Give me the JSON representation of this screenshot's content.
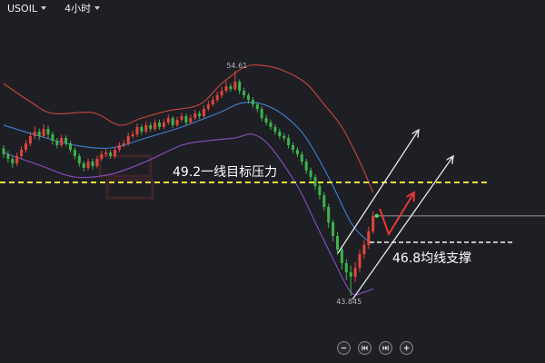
{
  "header": {
    "symbol": "USOIL",
    "timeframe": "4小时"
  },
  "controls": [
    {
      "icon": "zoom-out-icon"
    },
    {
      "icon": "jump-start-icon"
    },
    {
      "icon": "jump-end-icon"
    },
    {
      "icon": "zoom-in-icon"
    }
  ],
  "colors": {
    "background": "#1e1f24",
    "up": "#e0453c",
    "down": "#3cb44b",
    "band_upper": "#c9463d",
    "band_middle": "#3f7fd6",
    "band_lower": "#8a4fc0",
    "resistance": "#f2e535",
    "support": "#bdbdbd",
    "price_line": "#9a9a9a",
    "price_dot": "#4cd964",
    "arrow": "#e8e8e8",
    "forecast": "#e53935"
  },
  "chart_data": {
    "type": "candlestick",
    "ylim": [
      40.63,
      58.0
    ],
    "grid": false,
    "high_label": "54.61",
    "low_label": "43.845",
    "candles": [
      [
        50.9,
        51.05,
        50.45,
        50.62
      ],
      [
        50.62,
        50.78,
        50.22,
        50.4
      ],
      [
        50.4,
        50.55,
        49.98,
        50.18
      ],
      [
        50.18,
        50.7,
        50.05,
        50.53
      ],
      [
        50.53,
        51.0,
        50.4,
        50.83
      ],
      [
        50.83,
        51.3,
        50.7,
        51.14
      ],
      [
        51.14,
        51.68,
        51.0,
        51.49
      ],
      [
        51.49,
        51.95,
        51.35,
        51.7
      ],
      [
        51.7,
        51.85,
        51.3,
        51.49
      ],
      [
        51.49,
        52.05,
        51.4,
        51.83
      ],
      [
        51.83,
        51.98,
        51.4,
        51.57
      ],
      [
        51.57,
        51.7,
        51.1,
        51.27
      ],
      [
        51.27,
        51.4,
        50.9,
        51.05
      ],
      [
        51.05,
        51.55,
        50.95,
        51.4
      ],
      [
        51.4,
        51.52,
        51.0,
        51.14
      ],
      [
        51.14,
        51.25,
        50.7,
        50.83
      ],
      [
        50.83,
        50.95,
        50.38,
        50.53
      ],
      [
        50.53,
        50.65,
        50.02,
        50.18
      ],
      [
        50.18,
        50.3,
        49.8,
        49.97
      ],
      [
        49.97,
        50.42,
        49.85,
        50.27
      ],
      [
        50.27,
        50.4,
        49.9,
        50.05
      ],
      [
        50.05,
        50.55,
        49.95,
        50.4
      ],
      [
        50.4,
        50.78,
        50.3,
        50.62
      ],
      [
        50.62,
        50.88,
        50.5,
        50.7
      ],
      [
        50.7,
        50.82,
        50.4,
        50.53
      ],
      [
        50.53,
        50.98,
        50.42,
        50.83
      ],
      [
        50.83,
        51.2,
        50.72,
        51.05
      ],
      [
        51.05,
        51.3,
        50.95,
        51.14
      ],
      [
        51.14,
        51.65,
        51.02,
        51.49
      ],
      [
        51.49,
        51.75,
        51.38,
        51.57
      ],
      [
        51.57,
        52.1,
        51.45,
        51.92
      ],
      [
        51.92,
        52.05,
        51.55,
        51.7
      ],
      [
        51.7,
        52.2,
        51.6,
        52.01
      ],
      [
        52.01,
        52.15,
        51.7,
        51.83
      ],
      [
        51.83,
        52.3,
        51.72,
        52.14
      ],
      [
        52.14,
        52.28,
        51.8,
        51.92
      ],
      [
        51.92,
        52.3,
        51.82,
        52.14
      ],
      [
        52.14,
        52.52,
        52.02,
        52.35
      ],
      [
        52.35,
        52.45,
        51.88,
        52.01
      ],
      [
        52.01,
        52.42,
        51.92,
        52.27
      ],
      [
        52.27,
        52.6,
        52.15,
        52.44
      ],
      [
        52.44,
        52.55,
        52.02,
        52.14
      ],
      [
        52.14,
        52.5,
        52.05,
        52.35
      ],
      [
        52.35,
        52.75,
        52.25,
        52.57
      ],
      [
        52.57,
        52.7,
        52.3,
        52.44
      ],
      [
        52.44,
        52.95,
        52.35,
        52.79
      ],
      [
        52.79,
        53.18,
        52.68,
        53.0
      ],
      [
        53.0,
        53.4,
        52.9,
        53.22
      ],
      [
        53.22,
        53.62,
        53.1,
        53.44
      ],
      [
        53.44,
        53.85,
        53.3,
        53.66
      ],
      [
        53.66,
        54.1,
        53.55,
        53.87
      ],
      [
        53.87,
        54.0,
        53.6,
        53.74
      ],
      [
        53.74,
        54.61,
        53.65,
        54.09
      ],
      [
        54.09,
        54.2,
        53.5,
        53.66
      ],
      [
        53.66,
        53.8,
        53.3,
        53.44
      ],
      [
        53.44,
        53.55,
        53.05,
        53.22
      ],
      [
        53.22,
        53.35,
        52.85,
        53.0
      ],
      [
        53.0,
        53.12,
        52.62,
        52.79
      ],
      [
        52.79,
        52.9,
        52.2,
        52.35
      ],
      [
        52.35,
        52.5,
        52.0,
        52.14
      ],
      [
        52.14,
        52.28,
        51.78,
        51.92
      ],
      [
        51.92,
        52.05,
        51.55,
        51.7
      ],
      [
        51.7,
        51.85,
        51.35,
        51.49
      ],
      [
        51.49,
        51.62,
        51.25,
        51.4
      ],
      [
        51.4,
        51.55,
        50.9,
        51.05
      ],
      [
        51.05,
        51.18,
        50.68,
        50.83
      ],
      [
        50.83,
        50.95,
        50.48,
        50.62
      ],
      [
        50.62,
        50.75,
        50.1,
        50.27
      ],
      [
        50.27,
        50.4,
        49.68,
        49.84
      ],
      [
        49.84,
        49.98,
        49.35,
        49.53
      ],
      [
        49.53,
        49.65,
        48.92,
        49.1
      ],
      [
        49.1,
        49.25,
        48.45,
        48.66
      ],
      [
        48.66,
        48.8,
        47.9,
        48.1
      ],
      [
        48.1,
        48.25,
        47.1,
        47.36
      ],
      [
        47.36,
        47.5,
        46.45,
        46.71
      ],
      [
        46.71,
        46.9,
        45.8,
        46.06
      ],
      [
        46.06,
        46.25,
        45.1,
        45.41
      ],
      [
        45.41,
        45.6,
        44.6,
        44.97
      ],
      [
        44.97,
        45.3,
        43.845,
        44.76
      ],
      [
        44.76,
        45.45,
        44.5,
        45.19
      ],
      [
        45.19,
        46.05,
        45.0,
        45.84
      ],
      [
        45.84,
        46.5,
        45.6,
        46.28
      ],
      [
        46.28,
        47.15,
        46.1,
        46.93
      ],
      [
        46.93,
        47.9,
        46.8,
        47.67
      ]
    ],
    "bollinger": {
      "upper": [
        [
          0,
          54.0
        ],
        [
          6,
          53.13
        ],
        [
          11,
          52.57
        ],
        [
          20,
          52.61
        ],
        [
          26,
          52.01
        ],
        [
          31,
          52.35
        ],
        [
          37,
          52.7
        ],
        [
          44,
          53.0
        ],
        [
          49,
          54.0
        ],
        [
          54,
          54.78
        ],
        [
          58,
          54.87
        ],
        [
          63,
          54.61
        ],
        [
          68,
          54.0
        ],
        [
          72,
          53.0
        ],
        [
          76,
          51.92
        ],
        [
          80,
          50.27
        ],
        [
          83,
          48.79
        ]
      ],
      "middle": [
        [
          0,
          52.01
        ],
        [
          8,
          51.49
        ],
        [
          16,
          51.05
        ],
        [
          24,
          50.92
        ],
        [
          32,
          51.4
        ],
        [
          40,
          51.92
        ],
        [
          48,
          52.57
        ],
        [
          54,
          53.09
        ],
        [
          60,
          52.87
        ],
        [
          66,
          51.92
        ],
        [
          70,
          50.7
        ],
        [
          74,
          49.1
        ],
        [
          78,
          47.36
        ],
        [
          81,
          46.62
        ],
        [
          83,
          46.36
        ]
      ],
      "lower": [
        [
          0,
          50.7
        ],
        [
          8,
          50.1
        ],
        [
          16,
          49.53
        ],
        [
          24,
          49.66
        ],
        [
          32,
          50.27
        ],
        [
          40,
          51.05
        ],
        [
          46,
          51.27
        ],
        [
          52,
          51.4
        ],
        [
          56,
          51.57
        ],
        [
          60,
          50.96
        ],
        [
          66,
          49.1
        ],
        [
          70,
          47.36
        ],
        [
          74,
          45.62
        ],
        [
          78,
          44.02
        ],
        [
          81,
          44.02
        ],
        [
          83,
          44.19
        ]
      ]
    },
    "annotations": [
      {
        "label": "49.2一线目标压力"
      },
      {
        "label": "46.8均线支撑"
      }
    ]
  }
}
